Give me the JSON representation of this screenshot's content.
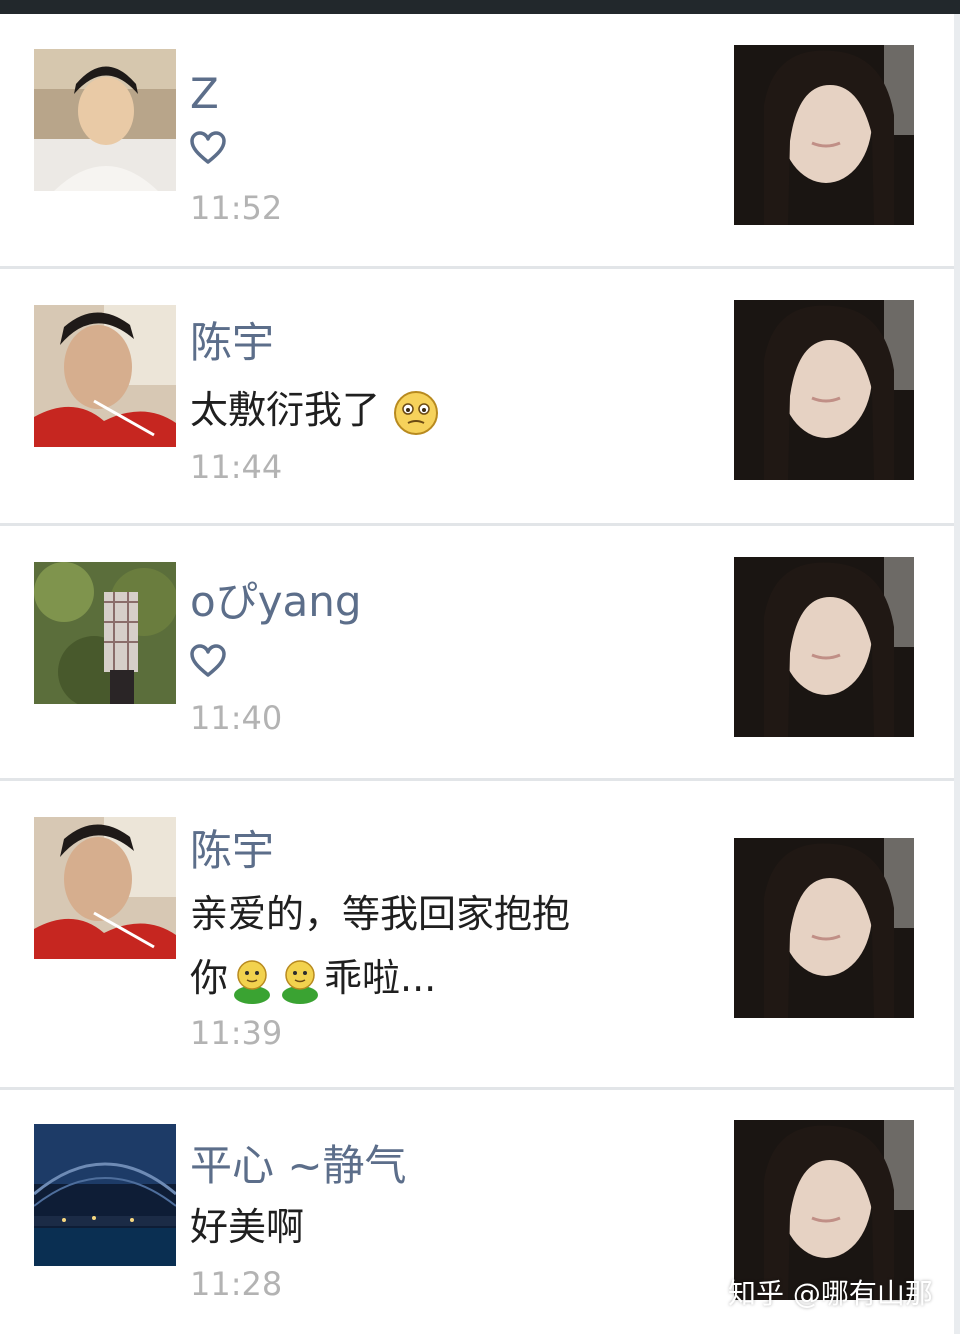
{
  "feed": {
    "items": [
      {
        "user": "Z",
        "message": "",
        "liked": true,
        "time": "11:52"
      },
      {
        "user": "陈宇",
        "message_text": "太敷衍我了",
        "message_emoji": "confused-face-emoji",
        "liked": false,
        "time": "11:44"
      },
      {
        "user": "oぴyang",
        "message": "",
        "liked": true,
        "time": "11:40"
      },
      {
        "user": "陈宇",
        "message_line1": "亲爱的，等我回家抱抱",
        "message_line2_prefix": "你",
        "message_line2_suffix": "乖啦...",
        "message_emoji": "hug-emoji",
        "liked": false,
        "time": "11:39"
      },
      {
        "user": "平心 ~静气",
        "message": "好美啊",
        "liked": false,
        "time": "11:28"
      }
    ]
  },
  "watermark": "知乎 @哪有山那",
  "colors": {
    "name": "#5c6e8a",
    "message": "#1f1f1f",
    "time": "#b3b3b3",
    "divider": "#e2e5e8",
    "topbar": "#22282c"
  }
}
